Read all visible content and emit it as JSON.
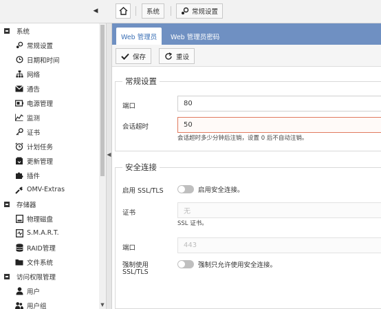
{
  "topbar": {
    "collapse_icon": "triangle-left-icon",
    "home_icon": "home-icon",
    "crumbs": [
      {
        "label": "系统"
      },
      {
        "label": "常规设置",
        "icon": "settings-icon"
      }
    ]
  },
  "sidebar": {
    "sections": [
      {
        "title": "系统",
        "items": [
          {
            "label": "常规设置",
            "icon": "settings-icon"
          },
          {
            "label": "日期和时间",
            "icon": "clock-icon"
          },
          {
            "label": "网络",
            "icon": "network-icon"
          },
          {
            "label": "通告",
            "icon": "mail-icon"
          },
          {
            "label": "电源管理",
            "icon": "power-icon"
          },
          {
            "label": "监测",
            "icon": "chart-icon"
          },
          {
            "label": "证书",
            "icon": "key-icon"
          },
          {
            "label": "计划任务",
            "icon": "alarm-icon"
          },
          {
            "label": "更新管理",
            "icon": "update-icon"
          },
          {
            "label": "插件",
            "icon": "puzzle-icon"
          },
          {
            "label": "OMV-Extras",
            "icon": "wrench-icon"
          }
        ]
      },
      {
        "title": "存储器",
        "items": [
          {
            "label": "物理磁盘",
            "icon": "disk-icon"
          },
          {
            "label": "S.M.A.R.T.",
            "icon": "smart-icon"
          },
          {
            "label": "RAID管理",
            "icon": "database-icon"
          },
          {
            "label": "文件系统",
            "icon": "folder-icon"
          }
        ]
      },
      {
        "title": "访问权限管理",
        "items": [
          {
            "label": "用户",
            "icon": "user-icon"
          },
          {
            "label": "用户组",
            "icon": "users-icon"
          }
        ]
      }
    ]
  },
  "main": {
    "tabs": [
      {
        "label": "Web 管理员",
        "active": true
      },
      {
        "label": "Web 管理员密码",
        "active": false
      }
    ],
    "toolbar": {
      "save_label": "保存",
      "reset_label": "重设"
    },
    "general": {
      "legend": "常规设置",
      "port_label": "端口",
      "port_value": "80",
      "timeout_label": "会话超时",
      "timeout_value": "50",
      "timeout_help": "会话超时多少分钟后注销，设置 0 后不自动注销。"
    },
    "secure": {
      "legend": "安全连接",
      "ssl_label": "启用 SSL/TLS",
      "ssl_toggle_text": "启用安全连接。",
      "ssl_enabled": false,
      "cert_label": "证书",
      "cert_placeholder": "无",
      "cert_help": "SSL 证书。",
      "port_label": "端口",
      "port_value": "443",
      "force_label_1": "强制使用",
      "force_label_2": "SSL/TLS",
      "force_toggle_text": "强制只允许使用安全连接。",
      "force_enabled": false
    }
  },
  "colors": {
    "tabstrip": "#6f90c2",
    "active_tab_text": "#3a6fb5",
    "invalid_border": "#e0795e"
  }
}
